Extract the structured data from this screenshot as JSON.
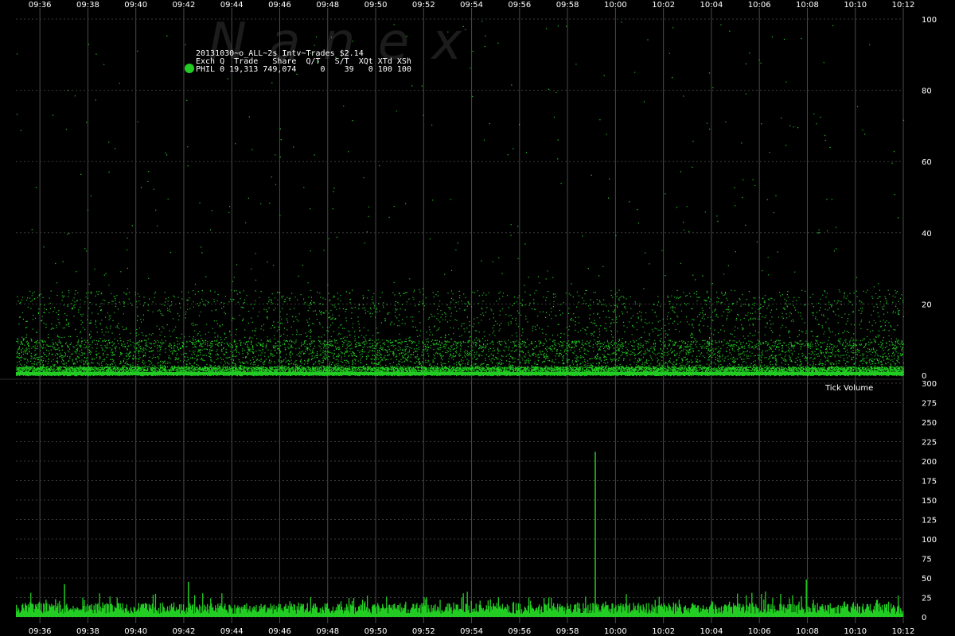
{
  "colors": {
    "background": "#000000",
    "series": "#22cc22",
    "grid_vertical": "#4a4a4a",
    "grid_horizontal": "#3a3a3a",
    "text": "#ffffff",
    "watermark": "#1c1c1c"
  },
  "watermark": "N a n e x",
  "legend": {
    "title": "20131030~o_ALL~2s Intv~Trades $2.14",
    "header": "Exch Q  Trade   Share  Q/T   S/T  XQt XTd XSh",
    "row": "PHIL 0 19,313 749,074     0    39   0 100 100",
    "marker_icon": "green-circle-icon"
  },
  "chart_data": [
    {
      "type": "scatter",
      "title": "",
      "x_ticks": [
        "09:36",
        "09:38",
        "09:40",
        "09:42",
        "09:44",
        "09:46",
        "09:48",
        "09:50",
        "09:52",
        "09:54",
        "09:56",
        "09:58",
        "10:00",
        "10:02",
        "10:04",
        "10:06",
        "10:08",
        "10:10",
        "10:12"
      ],
      "xlim": [
        "09:35:00",
        "10:12:00"
      ],
      "ylim": [
        0,
        100
      ],
      "y_ticks": [
        0,
        20,
        40,
        60,
        80,
        100
      ],
      "grid": true,
      "series": [
        {
          "trades": 19313,
          "value_range": [
            0,
            100
          ],
          "typical_range": [
            0,
            20
          ]
        }
      ]
    },
    {
      "type": "bar",
      "title": "Tick Volume",
      "x_ticks": [
        "09:36",
        "09:38",
        "09:40",
        "09:42",
        "09:44",
        "09:46",
        "09:48",
        "09:50",
        "09:52",
        "09:54",
        "09:56",
        "09:58",
        "10:00",
        "10:02",
        "10:04",
        "10:06",
        "10:08",
        "10:10",
        "10:12"
      ],
      "xlim": [
        "09:35:00",
        "10:12:00"
      ],
      "ylim": [
        0,
        300
      ],
      "y_ticks": [
        0,
        25,
        50,
        75,
        100,
        125,
        150,
        175,
        200,
        225,
        250,
        275,
        300
      ],
      "grid": true,
      "series": [
        {
          "interval_seconds": 2,
          "typical_range": [
            5,
            30
          ],
          "spikes": [
            {
              "x": "09:59:08",
              "value": 212
            },
            {
              "x": "09:42:10",
              "value": 45
            },
            {
              "x": "10:07:56",
              "value": 48
            },
            {
              "x": "09:37:00",
              "value": 42
            }
          ]
        }
      ]
    }
  ]
}
